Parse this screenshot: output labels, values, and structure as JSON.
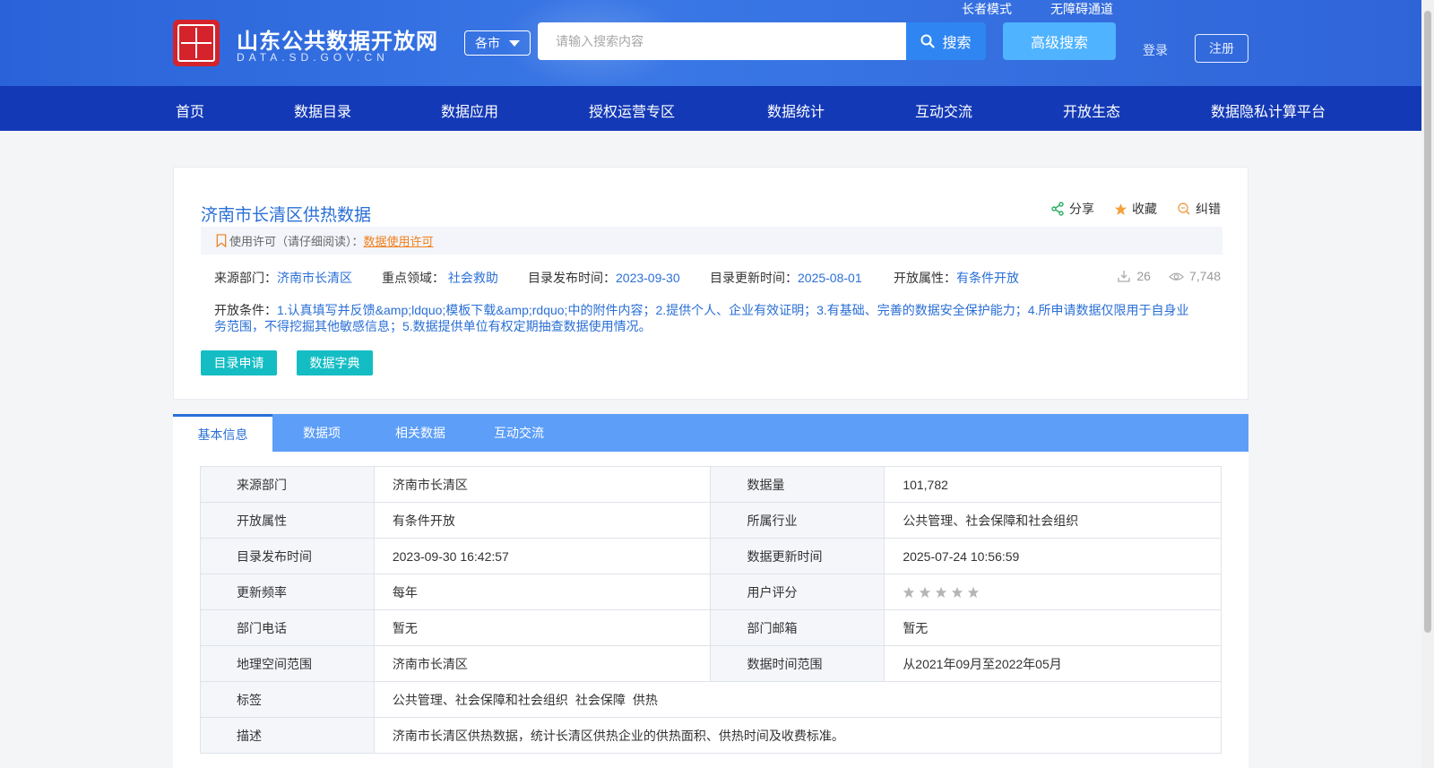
{
  "header": {
    "site_name": "山东公共数据开放网",
    "site_domain": "DATA.SD.GOV.CN",
    "city_select": "各市",
    "search_placeholder": "请输入搜索内容",
    "search_label": "搜索",
    "advanced_search_label": "高级搜索",
    "elder_mode": "长者模式",
    "accessibility": "无障碍通道",
    "login": "登录",
    "register": "注册"
  },
  "nav": [
    "首页",
    "数据目录",
    "数据应用",
    "授权运营专区",
    "数据统计",
    "互动交流",
    "开放生态",
    "数据隐私计算平台"
  ],
  "dataset": {
    "title": "济南市长清区供热数据",
    "actions": {
      "share": "分享",
      "favorite": "收藏",
      "report": "纠错"
    },
    "license_prefix": "使用许可（请仔细阅读）：",
    "license_link": "数据使用许可",
    "meta": {
      "source_label": "来源部门：",
      "source": "济南市长清区",
      "domain_label": "重点领域：",
      "domain": "社会救助",
      "publish_label": "目录发布时间：",
      "publish": "2023-09-30",
      "update_label": "目录更新时间：",
      "update": "2025-08-01",
      "open_label": "开放属性：",
      "open": "有条件开放"
    },
    "downloads": "26",
    "views": "7,748",
    "conditions_label": "开放条件：",
    "conditions": "1.认真填写并反馈&amp;ldquo;模板下载&amp;rdquo;中的附件内容；2.提供个人、企业有效证明；3.有基础、完善的数据安全保护能力；4.所申请数据仅限用于自身业务范围，不得挖掘其他敏感信息；5.数据提供单位有权定期抽查数据使用情况。",
    "apply_button": "目录申请",
    "dictionary_button": "数据字典"
  },
  "tabs": [
    "基本信息",
    "数据项",
    "相关数据",
    "互动交流"
  ],
  "info": {
    "source_dept_k": "来源部门",
    "source_dept_v": "济南市长清区",
    "data_volume_k": "数据量",
    "data_volume_v": "101,782",
    "open_attr_k": "开放属性",
    "open_attr_v": "有条件开放",
    "industry_k": "所属行业",
    "industry_v": "公共管理、社会保障和社会组织",
    "publish_time_k": "目录发布时间",
    "publish_time_v": "2023-09-30 16:42:57",
    "update_time_k": "数据更新时间",
    "update_time_v": "2025-07-24 10:56:59",
    "frequency_k": "更新频率",
    "frequency_v": "每年",
    "rating_k": "用户评分",
    "rating_v": 0,
    "phone_k": "部门电话",
    "phone_v": "暂无",
    "email_k": "部门邮箱",
    "email_v": "暂无",
    "geo_k": "地理空间范围",
    "geo_v": "济南市长清区",
    "time_range_k": "数据时间范围",
    "time_range_v": "从2021年09月至2022年05月",
    "tags_k": "标签",
    "tags": [
      "公共管理、社会保障和社会组织",
      "社会保障",
      "供热"
    ],
    "desc_k": "描述",
    "desc_v": "济南市长清区供热数据，统计长清区供热企业的供热面积、供热时间及收费标准。"
  },
  "colors": {
    "nav_bg": "#1339b6",
    "accent": "#2a6fd6",
    "teal": "#14bdc4",
    "tab_bg": "#5c9ef8"
  }
}
